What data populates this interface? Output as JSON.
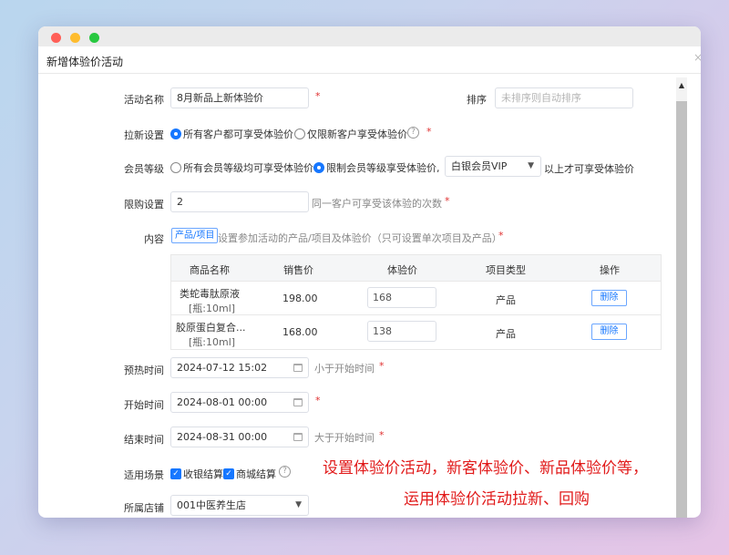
{
  "dialog": {
    "title": "新增体验价活动",
    "close": "×"
  },
  "form": {
    "activity_name": {
      "label": "活动名称",
      "value": "8月新品上新体验价"
    },
    "sort": {
      "label": "排序",
      "placeholder": "未排序则自动排序"
    },
    "pull_new": {
      "label": "拉新设置",
      "options": [
        "所有客户都可享受体验价",
        "仅限新客户享受体验价"
      ],
      "selected": 0
    },
    "member_level": {
      "label": "会员等级",
      "options": [
        "所有会员等级均可享受体验价",
        "限制会员等级享受体验价,"
      ],
      "selected": 1,
      "level_value": "白银会员VIP",
      "suffix": "以上才可享受体验价"
    },
    "limit": {
      "label": "限购设置",
      "value": "2",
      "hint": "同一客户可享受该体验的次数"
    },
    "content": {
      "label": "内容",
      "tag": "产品/项目",
      "hint": "设置参加活动的产品/项目及体验价（只可设置单次项目及产品）"
    },
    "table": {
      "headers": [
        "商品名称",
        "销售价",
        "体验价",
        "项目类型",
        "操作"
      ],
      "rows": [
        {
          "name": "类蛇毒肽原液",
          "spec": "[瓶:10ml]",
          "price": "198.00",
          "exp_price": "168",
          "type": "产品",
          "action": "删除"
        },
        {
          "name": "胶原蛋白复合...",
          "spec": "[瓶:10ml]",
          "price": "168.00",
          "exp_price": "138",
          "type": "产品",
          "action": "删除"
        }
      ]
    },
    "preheat": {
      "label": "预热时间",
      "value": "2024-07-12 15:02",
      "hint": "小于开始时间"
    },
    "start": {
      "label": "开始时间",
      "value": "2024-08-01 00:00"
    },
    "end": {
      "label": "结束时间",
      "value": "2024-08-31 00:00",
      "hint": "大于开始时间"
    },
    "scene": {
      "label": "适用场景",
      "options": [
        "收银结算",
        "商城结算"
      ]
    },
    "store": {
      "label": "所属店铺",
      "value": "001中医养生店"
    },
    "required_mark": "*",
    "help_mark": "?"
  },
  "caption": {
    "line1": "设置体验价活动，新客体验价、新品体验价等，",
    "line2": "运用体验价活动拉新、回购"
  },
  "colors": {
    "accent": "#1677ff",
    "required": "#e03030",
    "caption": "#e11a1a"
  }
}
